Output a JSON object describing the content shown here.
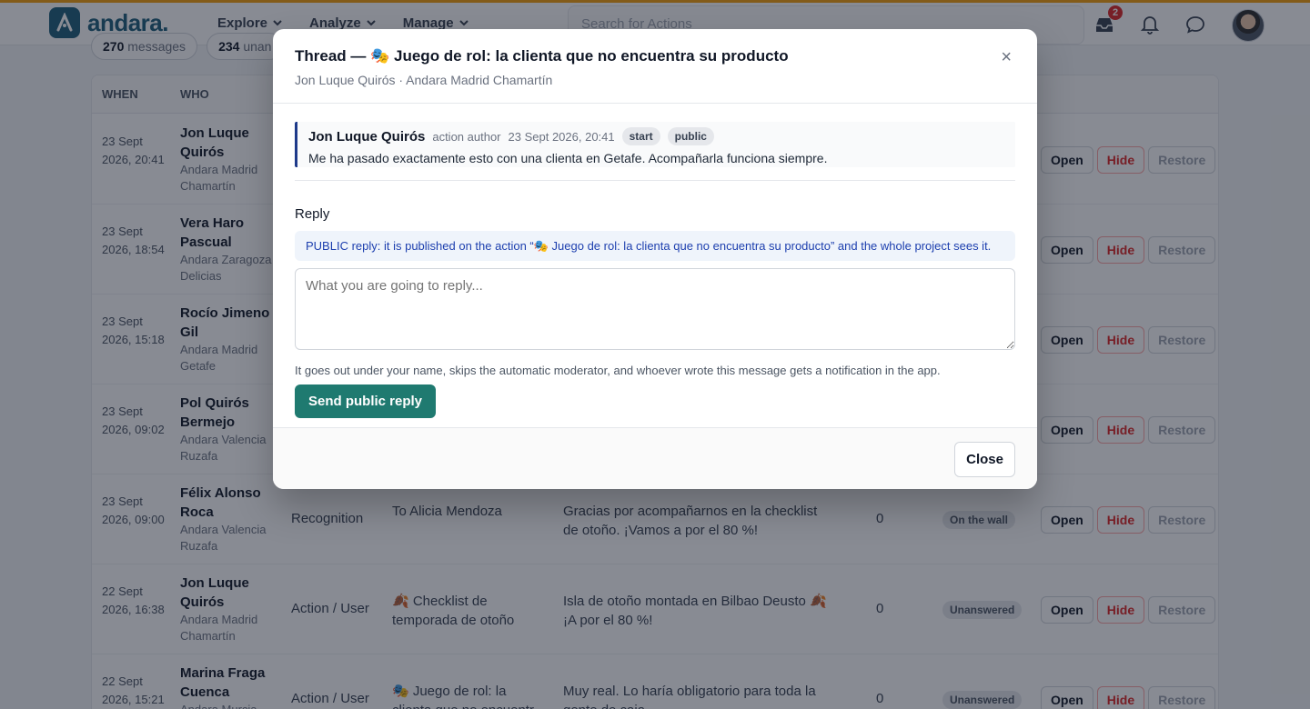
{
  "header": {
    "logo_text": "andara.",
    "nav": [
      "Explore",
      "Analyze",
      "Manage"
    ],
    "search_placeholder": "Search for Actions",
    "inbox_count": "2",
    "accent": "#f59e0b",
    "brand": "#1f5f7a"
  },
  "summary": {
    "messages_count": "270",
    "messages_label": "messages",
    "unanswered_count": "234",
    "unanswered_label": "unan"
  },
  "table": {
    "headers": {
      "when": "WHEN",
      "who": "WHO"
    },
    "rows": [
      {
        "when": "23 Sept 2026, 20:41",
        "name": "Jon Luque Quirós",
        "store": "Andara Madrid Chamartín",
        "type": "",
        "target": "",
        "message": "",
        "count": "",
        "status": ""
      },
      {
        "when": "23 Sept 2026, 18:54",
        "name": "Vera Haro Pascual",
        "store": "Andara Zaragoza Delicias",
        "type": "",
        "target": "",
        "message": "",
        "count": "",
        "status": ""
      },
      {
        "when": "23 Sept 2026, 15:18",
        "name": "Rocío Jimeno Gil",
        "store": "Andara Madrid Getafe",
        "type": "",
        "target": "",
        "message": "",
        "count": "",
        "status": ""
      },
      {
        "when": "23 Sept 2026, 09:02",
        "name": "Pol Quirós Bermejo",
        "store": "Andara Valencia Ruzafa",
        "type": "",
        "target": "",
        "message": "",
        "count": "",
        "status": ""
      },
      {
        "when": "23 Sept 2026, 09:00",
        "name": "Félix Alonso Roca",
        "store": "Andara Valencia Ruzafa",
        "type": "Recognition",
        "target": "To Alicia Mendoza",
        "message": "Gracias por acompañarnos en la checklist de otoño. ¡Vamos a por el 80 %!",
        "count": "0",
        "status": "On the wall"
      },
      {
        "when": "22 Sept 2026, 16:38",
        "name": "Jon Luque Quirós",
        "store": "Andara Madrid Chamartín",
        "type": "Action / User",
        "target": "🍂 Checklist de temporada de otoño",
        "message": "Isla de otoño montada en Bilbao Deusto 🍂 ¡A por el 80 %!",
        "count": "0",
        "status": "Unanswered"
      },
      {
        "when": "22 Sept 2026, 15:21",
        "name": "Marina Fraga Cuenca",
        "store": "Andara Murcia",
        "type": "Action / User",
        "target": "🎭 Juego de rol: la clienta que no encuentr",
        "message": "Muy real. Lo haría obligatorio para toda la gente de caja",
        "count": "0",
        "status": "Unanswered"
      }
    ],
    "actions": {
      "open": "Open",
      "hide": "Hide",
      "restore": "Restore"
    }
  },
  "modal": {
    "title": "Thread — 🎭 Juego de rol: la clienta que no encuentra su producto",
    "subtitle": "Jon Luque Quirós · Andara Madrid Chamartín",
    "close_x": "×",
    "message": {
      "author": "Jon Luque Quirós",
      "role": "action author",
      "date": "23 Sept 2026, 20:41",
      "tags": [
        "start",
        "public"
      ],
      "text": "Me ha pasado exactamente esto con una clienta en Getafe. Acompañarla funciona siempre."
    },
    "reply_label": "Reply",
    "info": "PUBLIC reply: it is published on the action “🎭 Juego de rol: la clienta que no encuentra su producto” and the whole project sees it.",
    "reply_placeholder": "What you are going to reply...",
    "hint": "It goes out under your name, skips the automatic moderator, and whoever wrote this message gets a notification in the app.",
    "send_label": "Send public reply",
    "close_label": "Close"
  }
}
